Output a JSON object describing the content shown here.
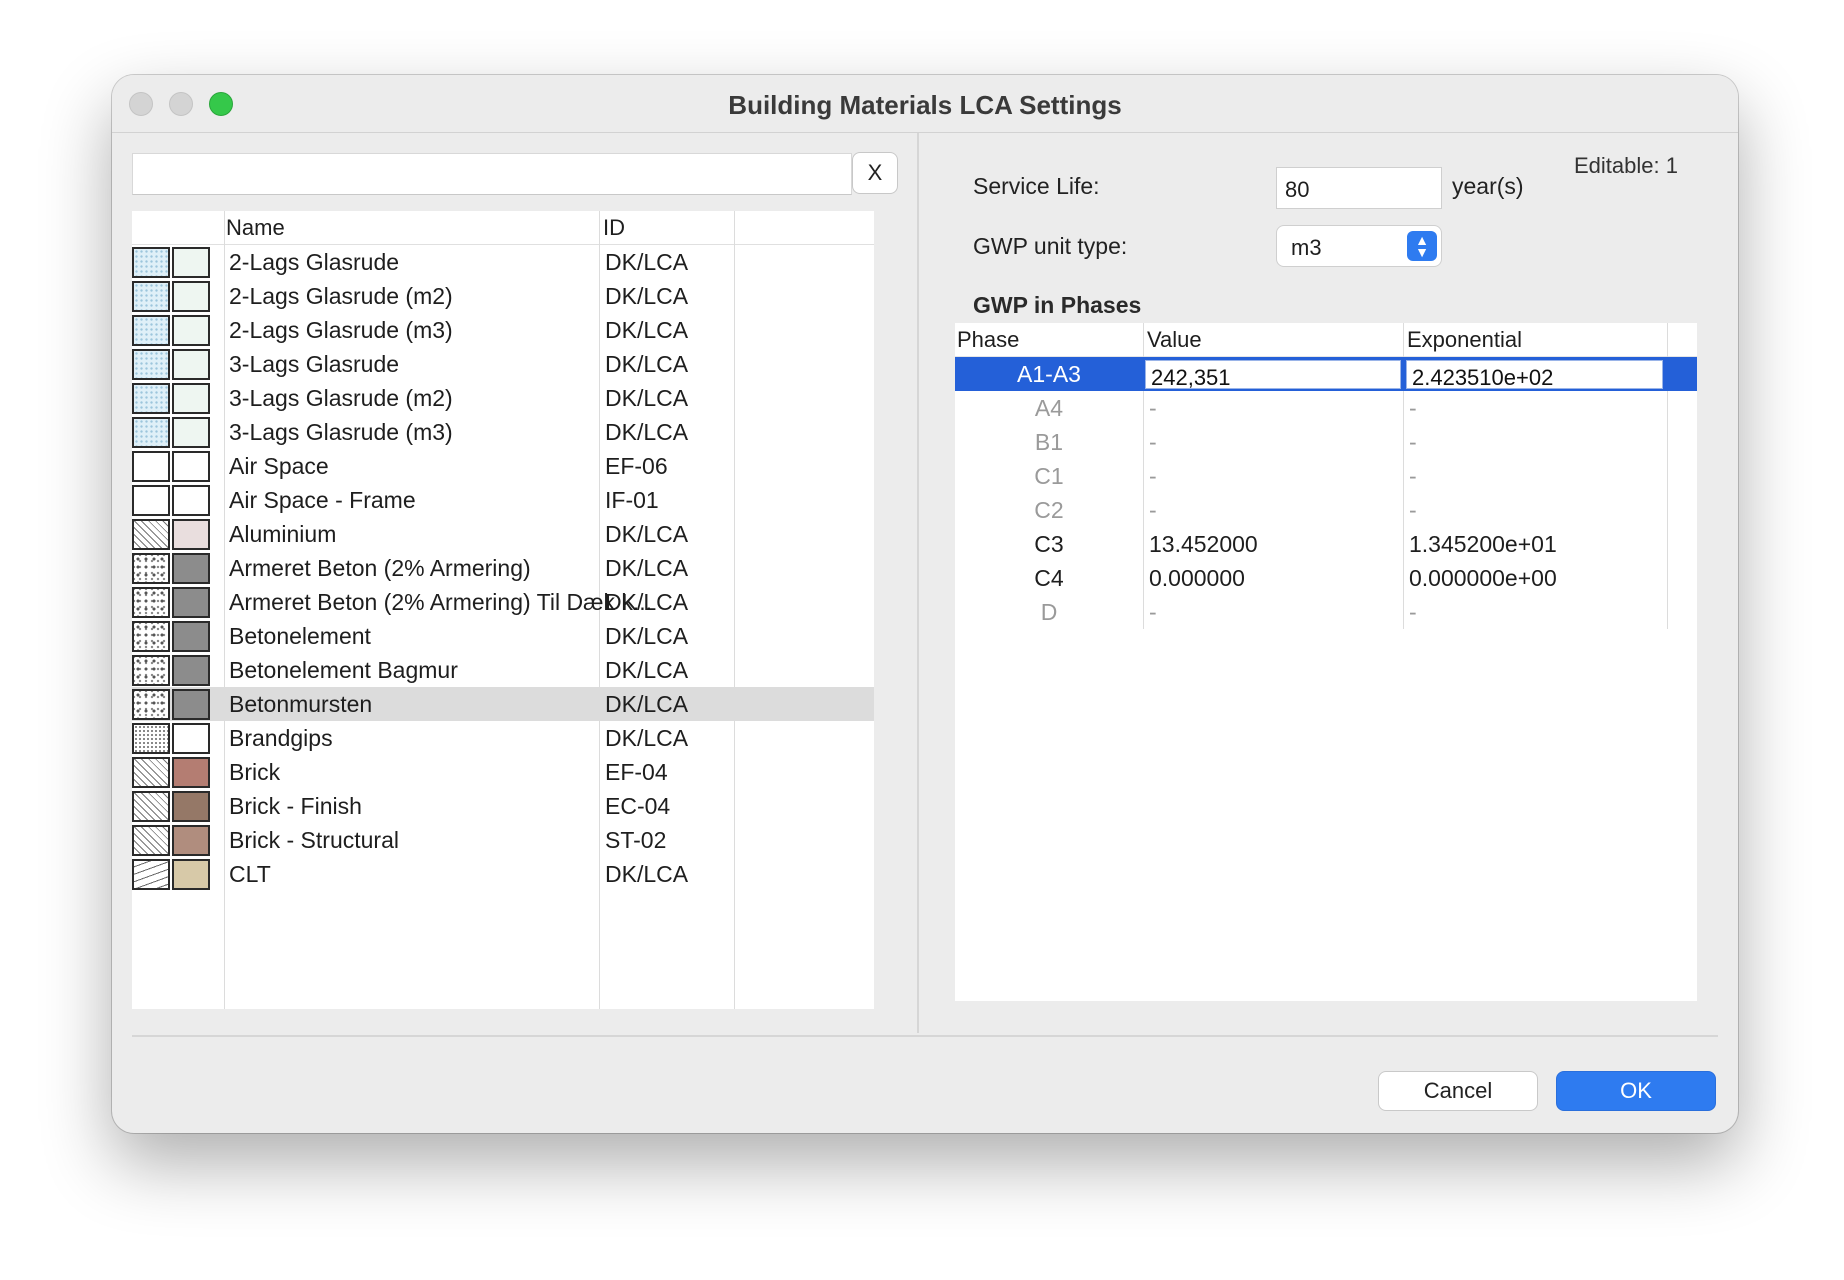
{
  "window": {
    "title": "Building Materials LCA Settings"
  },
  "search": {
    "value": "",
    "clear_label": "X"
  },
  "materials": {
    "headers": {
      "name": "Name",
      "id": "ID"
    },
    "rows": [
      {
        "name": "2-Lags Glasrude",
        "id": "DK/LCA",
        "pattern": "glass",
        "color": "#eef6f1"
      },
      {
        "name": "2-Lags Glasrude (m2)",
        "id": "DK/LCA",
        "pattern": "glass",
        "color": "#eef6f1"
      },
      {
        "name": "2-Lags Glasrude (m3)",
        "id": "DK/LCA",
        "pattern": "glass",
        "color": "#eef6f1"
      },
      {
        "name": "3-Lags Glasrude",
        "id": "DK/LCA",
        "pattern": "glass",
        "color": "#eef6f1"
      },
      {
        "name": "3-Lags Glasrude (m2)",
        "id": "DK/LCA",
        "pattern": "glass",
        "color": "#eef6f1"
      },
      {
        "name": "3-Lags Glasrude (m3)",
        "id": "DK/LCA",
        "pattern": "glass",
        "color": "#eef6f1"
      },
      {
        "name": "Air Space",
        "id": "EF-06",
        "pattern": "solid-white",
        "color": "#ffffff"
      },
      {
        "name": "Air Space - Frame",
        "id": "IF-01",
        "pattern": "solid-white",
        "color": "#ffffff"
      },
      {
        "name": "Aluminium",
        "id": "DK/LCA",
        "pattern": "diag",
        "color": "#e9dede"
      },
      {
        "name": "Armeret Beton (2% Armering)",
        "id": "DK/LCA",
        "pattern": "dots",
        "color": "#8c8c8c"
      },
      {
        "name": "Armeret Beton (2% Armering) Til Dæk k...",
        "id": "DK/LCA",
        "pattern": "dots",
        "color": "#8c8c8c"
      },
      {
        "name": "Betonelement",
        "id": "DK/LCA",
        "pattern": "dots",
        "color": "#8c8c8c"
      },
      {
        "name": "Betonelement Bagmur",
        "id": "DK/LCA",
        "pattern": "dots",
        "color": "#8c8c8c"
      },
      {
        "name": "Betonmursten",
        "id": "DK/LCA",
        "pattern": "dots",
        "color": "#8c8c8c",
        "selected": true
      },
      {
        "name": "Brandgips",
        "id": "DK/LCA",
        "pattern": "fine",
        "color": "#ffffff"
      },
      {
        "name": "Brick",
        "id": "EF-04",
        "pattern": "diag",
        "color": "#b47d72"
      },
      {
        "name": "Brick - Finish",
        "id": "EC-04",
        "pattern": "diag",
        "color": "#957867"
      },
      {
        "name": "Brick - Structural",
        "id": "ST-02",
        "pattern": "diag",
        "color": "#b08d7e"
      },
      {
        "name": "CLT",
        "id": "DK/LCA",
        "pattern": "wave",
        "color": "#d7c9a8"
      }
    ]
  },
  "settings": {
    "service_life_label": "Service Life:",
    "service_life_value": "80",
    "service_life_unit": "year(s)",
    "gwp_unit_label": "GWP unit type:",
    "gwp_unit_value": "m3",
    "editable": "Editable: 1"
  },
  "phases": {
    "title": "GWP in Phases",
    "headers": {
      "phase": "Phase",
      "value": "Value",
      "exponential": "Exponential"
    },
    "rows": [
      {
        "phase": "A1-A3",
        "value": "242,351",
        "exponential": "2.423510e+02",
        "selected": true
      },
      {
        "phase": "A4",
        "value": "-",
        "exponential": "-",
        "dim": true
      },
      {
        "phase": "B1",
        "value": "-",
        "exponential": "-",
        "dim": true
      },
      {
        "phase": "C1",
        "value": "-",
        "exponential": "-",
        "dim": true
      },
      {
        "phase": "C2",
        "value": "-",
        "exponential": "-",
        "dim": true
      },
      {
        "phase": "C3",
        "value": "13.452000",
        "exponential": "1.345200e+01"
      },
      {
        "phase": "C4",
        "value": "0.000000",
        "exponential": "0.000000e+00"
      },
      {
        "phase": "D",
        "value": "-",
        "exponential": "-",
        "dim": true
      }
    ]
  },
  "buttons": {
    "cancel": "Cancel",
    "ok": "OK"
  }
}
